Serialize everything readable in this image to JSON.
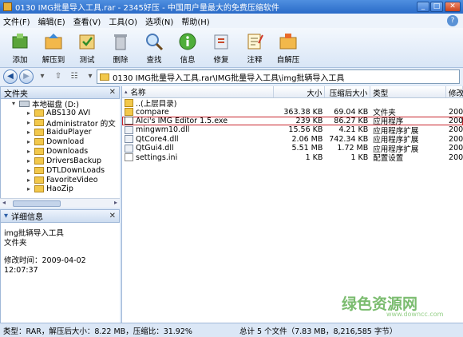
{
  "window": {
    "title": "0130  IMG批量导入工具.rar - 2345好压 - 中国用户量最大的免费压缩软件"
  },
  "menu": [
    "文件(F)",
    "编辑(E)",
    "查看(V)",
    "工具(O)",
    "选项(N)",
    "帮助(H)"
  ],
  "toolbar": [
    {
      "label": "添加",
      "icon": "add-icon"
    },
    {
      "label": "解压到",
      "icon": "extract-to-icon"
    },
    {
      "label": "测试",
      "icon": "test-icon"
    },
    {
      "label": "删除",
      "icon": "delete-icon"
    },
    {
      "label": "查找",
      "icon": "search-icon"
    },
    {
      "label": "信息",
      "icon": "info-icon"
    },
    {
      "label": "修复",
      "icon": "repair-icon"
    },
    {
      "label": "注释",
      "icon": "comment-icon"
    },
    {
      "label": "自解压",
      "icon": "sfx-icon"
    }
  ],
  "address": {
    "path": "0130  IMG批量导入工具.rar\\IMG批量导入工具\\img批辆导入工具"
  },
  "left_panel": {
    "header": "文件夹",
    "tree": [
      {
        "label": "本地磁盘 (D:)",
        "type": "drive",
        "level": 1
      },
      {
        "label": "ABS130 AVI",
        "type": "folder",
        "level": 2
      },
      {
        "label": "Administrator 的文",
        "type": "folder",
        "level": 2
      },
      {
        "label": "BaiduPlayer",
        "type": "folder",
        "level": 2
      },
      {
        "label": "Download",
        "type": "folder",
        "level": 2
      },
      {
        "label": "Downloads",
        "type": "folder",
        "level": 2
      },
      {
        "label": "DriversBackup",
        "type": "folder",
        "level": 2
      },
      {
        "label": "DTLDownLoads",
        "type": "folder",
        "level": 2
      },
      {
        "label": "FavoriteVideo",
        "type": "folder",
        "level": 2
      },
      {
        "label": "HaoZip",
        "type": "folder",
        "level": 2
      }
    ]
  },
  "info_panel": {
    "header": "详细信息",
    "name": "img批辆导入工具",
    "kind": "文件夹",
    "modified": "修改时间：2009-04-02 12:07:37"
  },
  "file_list": {
    "columns": [
      "名称",
      "大小",
      "压缩后大小",
      "类型",
      "修改"
    ],
    "rows": [
      {
        "name": "..(上层目录)",
        "size": "",
        "packed": "",
        "type": "",
        "mod": "",
        "icon": "fold"
      },
      {
        "name": "compare",
        "size": "363.38 KB",
        "packed": "69.04 KB",
        "type": "文件夹",
        "mod": "2009",
        "icon": "fold"
      },
      {
        "name": "Alci's IMG Editor 1.5.exe",
        "size": "239 KB",
        "packed": "86.27 KB",
        "type": "应用程序",
        "mod": "2007",
        "icon": "exe",
        "selected": true
      },
      {
        "name": "mingwm10.dll",
        "size": "15.56 KB",
        "packed": "4.21 KB",
        "type": "应用程序扩展",
        "mod": "2006",
        "icon": "dll"
      },
      {
        "name": "QtCore4.dll",
        "size": "2.06 MB",
        "packed": "742.34 KB",
        "type": "应用程序扩展",
        "mod": "2006",
        "icon": "dll"
      },
      {
        "name": "QtGui4.dll",
        "size": "5.51 MB",
        "packed": "1.72 MB",
        "type": "应用程序扩展",
        "mod": "2006",
        "icon": "dll"
      },
      {
        "name": "settings.ini",
        "size": "1 KB",
        "packed": "1 KB",
        "type": "配置设置",
        "mod": "2008",
        "icon": "ini"
      }
    ]
  },
  "status": {
    "left": "类型：RAR，解压后大小：8.22 MB，压缩比：31.92%",
    "right": "总计 5 个文件（7.83 MB，8,216,585 字节）"
  },
  "watermark": {
    "main": "绿色资源网",
    "sub": "www.downcc.com"
  }
}
